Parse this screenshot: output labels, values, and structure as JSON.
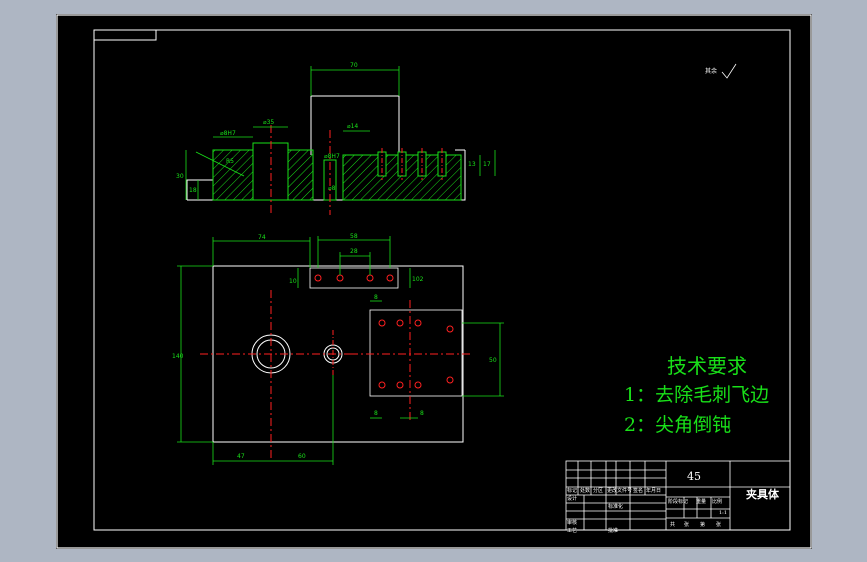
{
  "colors": {
    "outside": "#aeb6c3",
    "sheet": "#000000",
    "part_line": "#ffffff",
    "dimension": "#19e019",
    "hatch": "#19e019",
    "center_line": "#ff2020",
    "hole": "#ff2020"
  },
  "technical_requirements": {
    "title": "技术要求",
    "items": [
      "1：去除毛刺飞边",
      "2：尖角倒钝"
    ]
  },
  "roughness_note": "其余",
  "title_block": {
    "material": "45",
    "part_name": "夹具体",
    "scale": "1:1",
    "header_labels": [
      "标记",
      "处数",
      "分区",
      "更改文件号",
      "签名",
      "年月日"
    ],
    "role_labels": [
      "设计",
      "审核",
      "工艺"
    ],
    "std_labels": [
      "标准化",
      "批准"
    ],
    "stage_labels": [
      "阶段标记",
      "重量",
      "比例"
    ],
    "sheet_labels": [
      "共",
      "张",
      "第",
      "张"
    ]
  },
  "section_view": {
    "dims": {
      "width_top": "70",
      "dia_bore": "⌀35",
      "dia_fit": "⌀8H7",
      "dia_fit2": "⌀8H7",
      "dia_14": "⌀14",
      "height_total": "30",
      "height_base": "18",
      "height_right": "17",
      "height_right2": "13",
      "chamfer": "R5",
      "spot": "⌀8"
    }
  },
  "plan_view": {
    "dims": {
      "d74": "74",
      "d58": "58",
      "d28": "28",
      "d10": "10",
      "d140": "140",
      "d8": "8",
      "d50": "50",
      "d8b": "8",
      "d8c": "8",
      "d47": "47",
      "d60": "60",
      "d102": "102"
    }
  }
}
